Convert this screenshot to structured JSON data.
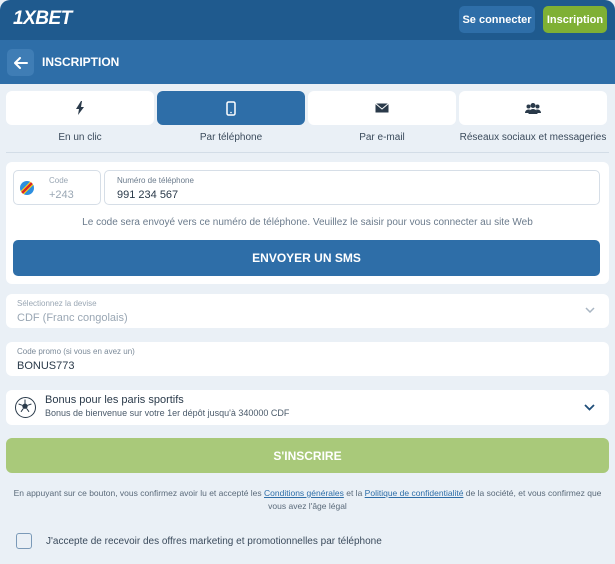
{
  "topbar": {
    "logo_prefix": "1X",
    "logo_suffix": "BET",
    "login_label": "Se connecter",
    "register_label": "Inscription"
  },
  "header": {
    "title": "INSCRIPTION"
  },
  "tabs": [
    {
      "label": "En un clic",
      "icon": "lightning-icon"
    },
    {
      "label": "Par téléphone",
      "icon": "phone-icon",
      "active": true
    },
    {
      "label": "Par e-mail",
      "icon": "envelope-icon"
    },
    {
      "label": "Réseaux sociaux et messageries",
      "icon": "users-icon"
    }
  ],
  "phone_form": {
    "code_label": "Code",
    "code_value": "+243",
    "phone_label": "Numéro de téléphone",
    "phone_value": "991 234 567",
    "hint": "Le code sera envoyé vers ce numéro de téléphone. Veuillez le saisir pour vous connecter au site Web",
    "sms_button": "ENVOYER UN SMS"
  },
  "currency": {
    "label": "Sélectionnez la devise",
    "value": "CDF  (Franc congolais)"
  },
  "promo": {
    "label": "Code promo (si vous en avez un)",
    "value": "BONUS773"
  },
  "bonus": {
    "title": "Bonus pour les paris sportifs",
    "subtitle": "Bonus de bienvenue sur votre 1er dépôt jusqu'à 340000 CDF"
  },
  "signup_button": "S'INSCRIRE",
  "legal": {
    "part1": "En appuyant sur ce bouton, vous confirmez avoir lu et accepté les ",
    "terms_link": "Conditions générales",
    "part2": " et la ",
    "privacy_link": "Politique de confidentialité",
    "part3": " de la société, et vous confirmez que vous avez l'âge légal"
  },
  "marketing_checkbox": {
    "label": "J'accepte de recevoir des offres marketing et promotionnelles par téléphone",
    "checked": false
  },
  "colors": {
    "primary": "#2e6ea8",
    "topbar": "#1f5a8e",
    "green": "#7fb034",
    "disabled_green": "#a9c97a"
  }
}
